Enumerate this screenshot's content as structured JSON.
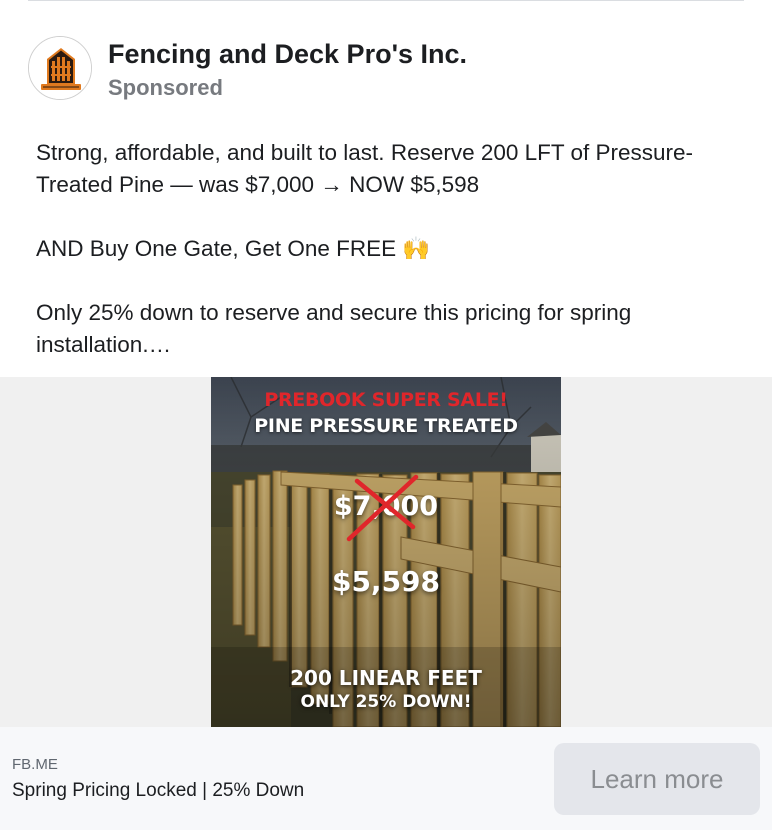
{
  "post": {
    "page_name": "Fencing and Deck Pro's Inc.",
    "sponsored_label": "Sponsored",
    "avatar_icon": "fence-logo-icon",
    "body": {
      "line1": "Strong, affordable, and built to last. Reserve 200 LFT of Pressure-Treated Pine — was $7,000 → NOW $5,598",
      "line2": "AND Buy One Gate, Get One FREE 🙌",
      "line3": "Only 25% down to reserve and secure this pricing for spring installation.…"
    }
  },
  "ad_image": {
    "headline": "PREBOOK SUPER SALE!",
    "subheadline": "PINE PRESSURE TREATED",
    "old_price": "$7,000",
    "new_price": "$5,598",
    "feet_line": "200 LINEAR FEET",
    "down_line": "ONLY 25% DOWN!",
    "headline_color": "#e0262b",
    "strike_color": "#e0262b"
  },
  "link": {
    "domain": "FB.ME",
    "title": "Spring Pricing Locked | 25% Down",
    "cta_label": "Learn more"
  }
}
